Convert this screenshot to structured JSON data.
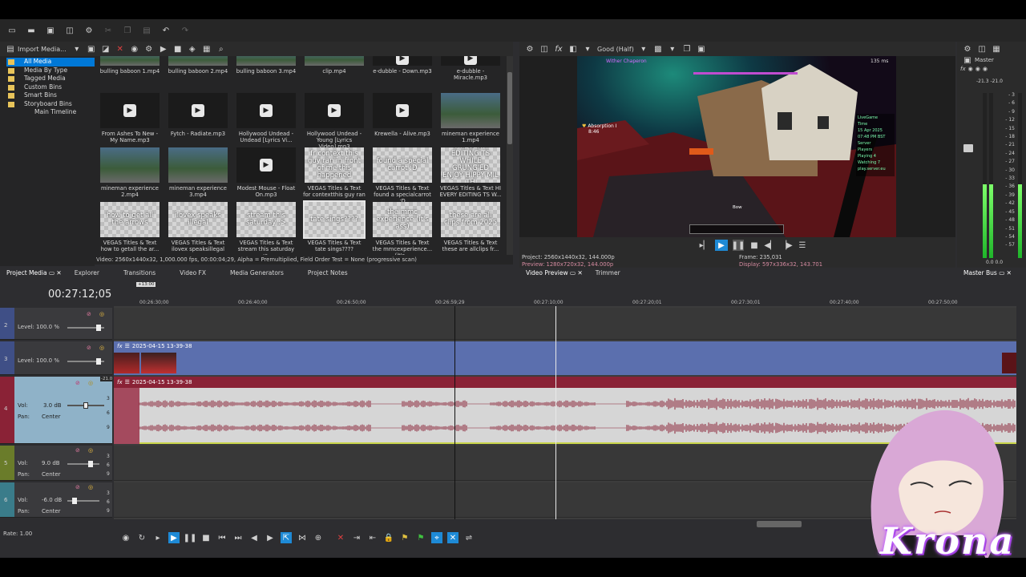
{
  "project_media": {
    "import_label": "Import Media...",
    "tree": [
      {
        "label": "All Media",
        "selected": true
      },
      {
        "label": "Media By Type"
      },
      {
        "label": "Tagged Media"
      },
      {
        "label": "Custom Bins"
      },
      {
        "label": "Smart Bins"
      },
      {
        "label": "Storyboard Bins"
      },
      {
        "label": "Main Timeline"
      }
    ],
    "items": [
      {
        "kind": "video",
        "label": "bulling baboon 1.mp4"
      },
      {
        "kind": "video",
        "label": "bulling baboon 2.mp4"
      },
      {
        "kind": "video",
        "label": "bulling baboon 3.mp4"
      },
      {
        "kind": "video",
        "label": "clip.mp4"
      },
      {
        "kind": "audio",
        "label": "e-dubble - Down.mp3"
      },
      {
        "kind": "audio",
        "label": "e-dubble - Miracle.mp3"
      },
      {
        "kind": "audio",
        "label": "From Ashes To New - My Name.mp3"
      },
      {
        "kind": "audio",
        "label": "Fytch - Radiate.mp3"
      },
      {
        "kind": "audio",
        "label": "Hollywood Undead - Undead [Lyrics Vi..."
      },
      {
        "kind": "audio",
        "label": "Hollywood Undead - Young [Lyrics Video].mp3"
      },
      {
        "kind": "audio",
        "label": "Krewella - Alive.mp3"
      },
      {
        "kind": "video",
        "label": "mineman experience 1.mp4"
      },
      {
        "kind": "video",
        "label": "mineman experience 2.mp4"
      },
      {
        "kind": "video",
        "label": "mineman experience 3.mp4"
      },
      {
        "kind": "audio",
        "label": "Modest Mouse - Float On.mp3"
      },
      {
        "kind": "title",
        "thumb": "fr context this guy ran in front of me this happened",
        "label": "VEGAS Titles & Text for contextthis guy ran ..."
      },
      {
        "kind": "title",
        "thumb": "found a special carrot :D",
        "label": "VEGAS Titles & Text found a specialcarrot :D"
      },
      {
        "kind": "title",
        "thumb": "HI EVERY EDITING TS WHILE GRUNG'ED ENJOY HIPPY MIL TH",
        "label": "VEGAS Titles & Text HI EVERY EDITING TS W..."
      },
      {
        "kind": "title",
        "thumb": "how to get all the arrows",
        "label": "VEGAS Titles & Text how to getall the ar..."
      },
      {
        "kind": "title",
        "thumb": "ilovex speaks illegal",
        "label": "VEGAS Titles & Text ilovex speaksillegal"
      },
      {
        "kind": "title",
        "thumb": "stream this saturday :>",
        "label": "VEGAS Titles & Text stream this saturday :>"
      },
      {
        "kind": "title",
        "thumb": "tate sings????",
        "label": "VEGAS Titles & Text tate sings????",
        "selected": true
      },
      {
        "kind": "title",
        "thumb": "the mmc experience (it's ass)",
        "label": "VEGAS Titles & Text the mmcexperience...(it's..."
      },
      {
        "kind": "title",
        "thumb": "these are all clips from 2025",
        "label": "VEGAS Titles & Text these are allclips fr..."
      }
    ],
    "status": "Video: 2560x1440x32, 1,000.000 fps, 00:00:04;29, Alpha = Premultiplied, Field Order Test = None (progressive scan)",
    "tabs": [
      "Project Media",
      "Explorer",
      "Transitions",
      "Video FX",
      "Media Generators",
      "Project Notes"
    ]
  },
  "preview": {
    "quality": "Good (Half)",
    "project_line": "Project:  2560x1440x32, 144.000p",
    "preview_line": "Preview:  1280x720x32, 144.000p",
    "frame_line": "Frame:   235,031",
    "display_line": "Display:  597x336x32, 143.701",
    "tabs": [
      "Video Preview",
      "Trimmer"
    ],
    "hud": {
      "boss": "Wither Chaperon",
      "absorption": "Absorption I",
      "time": "8:46",
      "ping": "135 ms",
      "sidebar": [
        "LiveGame",
        "Time",
        "15 Apr 2025",
        "07:48 PM BST",
        "Server",
        "Players",
        "Playing 4",
        "Watching 7",
        "play.server.eu"
      ],
      "hotbar_label": "Bow"
    }
  },
  "master_bus": {
    "label": "Master",
    "levels": [
      "-21.3",
      "-21.0"
    ],
    "scale": [
      "3",
      "6",
      "9",
      "12",
      "15",
      "18",
      "21",
      "24",
      "27",
      "30",
      "33",
      "36",
      "39",
      "42",
      "45",
      "48",
      "51",
      "54",
      "57"
    ],
    "bottom": [
      "0.0",
      "0.0"
    ],
    "tab": "Master Bus"
  },
  "timeline": {
    "timecode": "00:27:12;05",
    "small_marker": "+13:00",
    "ruler": [
      "00:26:30;00",
      "00:26:40;00",
      "00:26:50;00",
      "00:26:59;29",
      "00:27:10;00",
      "00:27:20;01",
      "00:27:30;01",
      "00:27:40;00",
      "00:27:50;00"
    ],
    "tracks": [
      {
        "num": "2",
        "kind": "video",
        "level": "Level: 100.0 %"
      },
      {
        "num": "3",
        "kind": "video",
        "level": "Level: 100.0 %",
        "clip": "2025-04-15 13-39-38"
      },
      {
        "num": "4",
        "kind": "audio",
        "vol": "3.0 dB",
        "pan": "Center",
        "clip": "2025-04-15 13-39-38",
        "meter_scale": [
          "3",
          "6",
          "9"
        ],
        "peak": "-21.0"
      },
      {
        "num": "5",
        "kind": "audio",
        "vol": "9.0 dB",
        "pan": "Center",
        "meter_scale": [
          "3",
          "6",
          "9"
        ]
      },
      {
        "num": "6",
        "kind": "audio",
        "vol": "-6.0 dB",
        "pan": "Center",
        "meter_scale": [
          "3",
          "6",
          "9"
        ]
      }
    ],
    "rate": "Rate: 1.00",
    "vol_label": "Vol:",
    "pan_label": "Pan:"
  },
  "overlay": {
    "watermark": "Krona"
  },
  "colors": {
    "video_track": "#5b6fae",
    "audio_track": "#8a2236",
    "audio_bg": "#d6d6d6",
    "accent": "#0078d7",
    "meter_green": "#2ecc40"
  }
}
